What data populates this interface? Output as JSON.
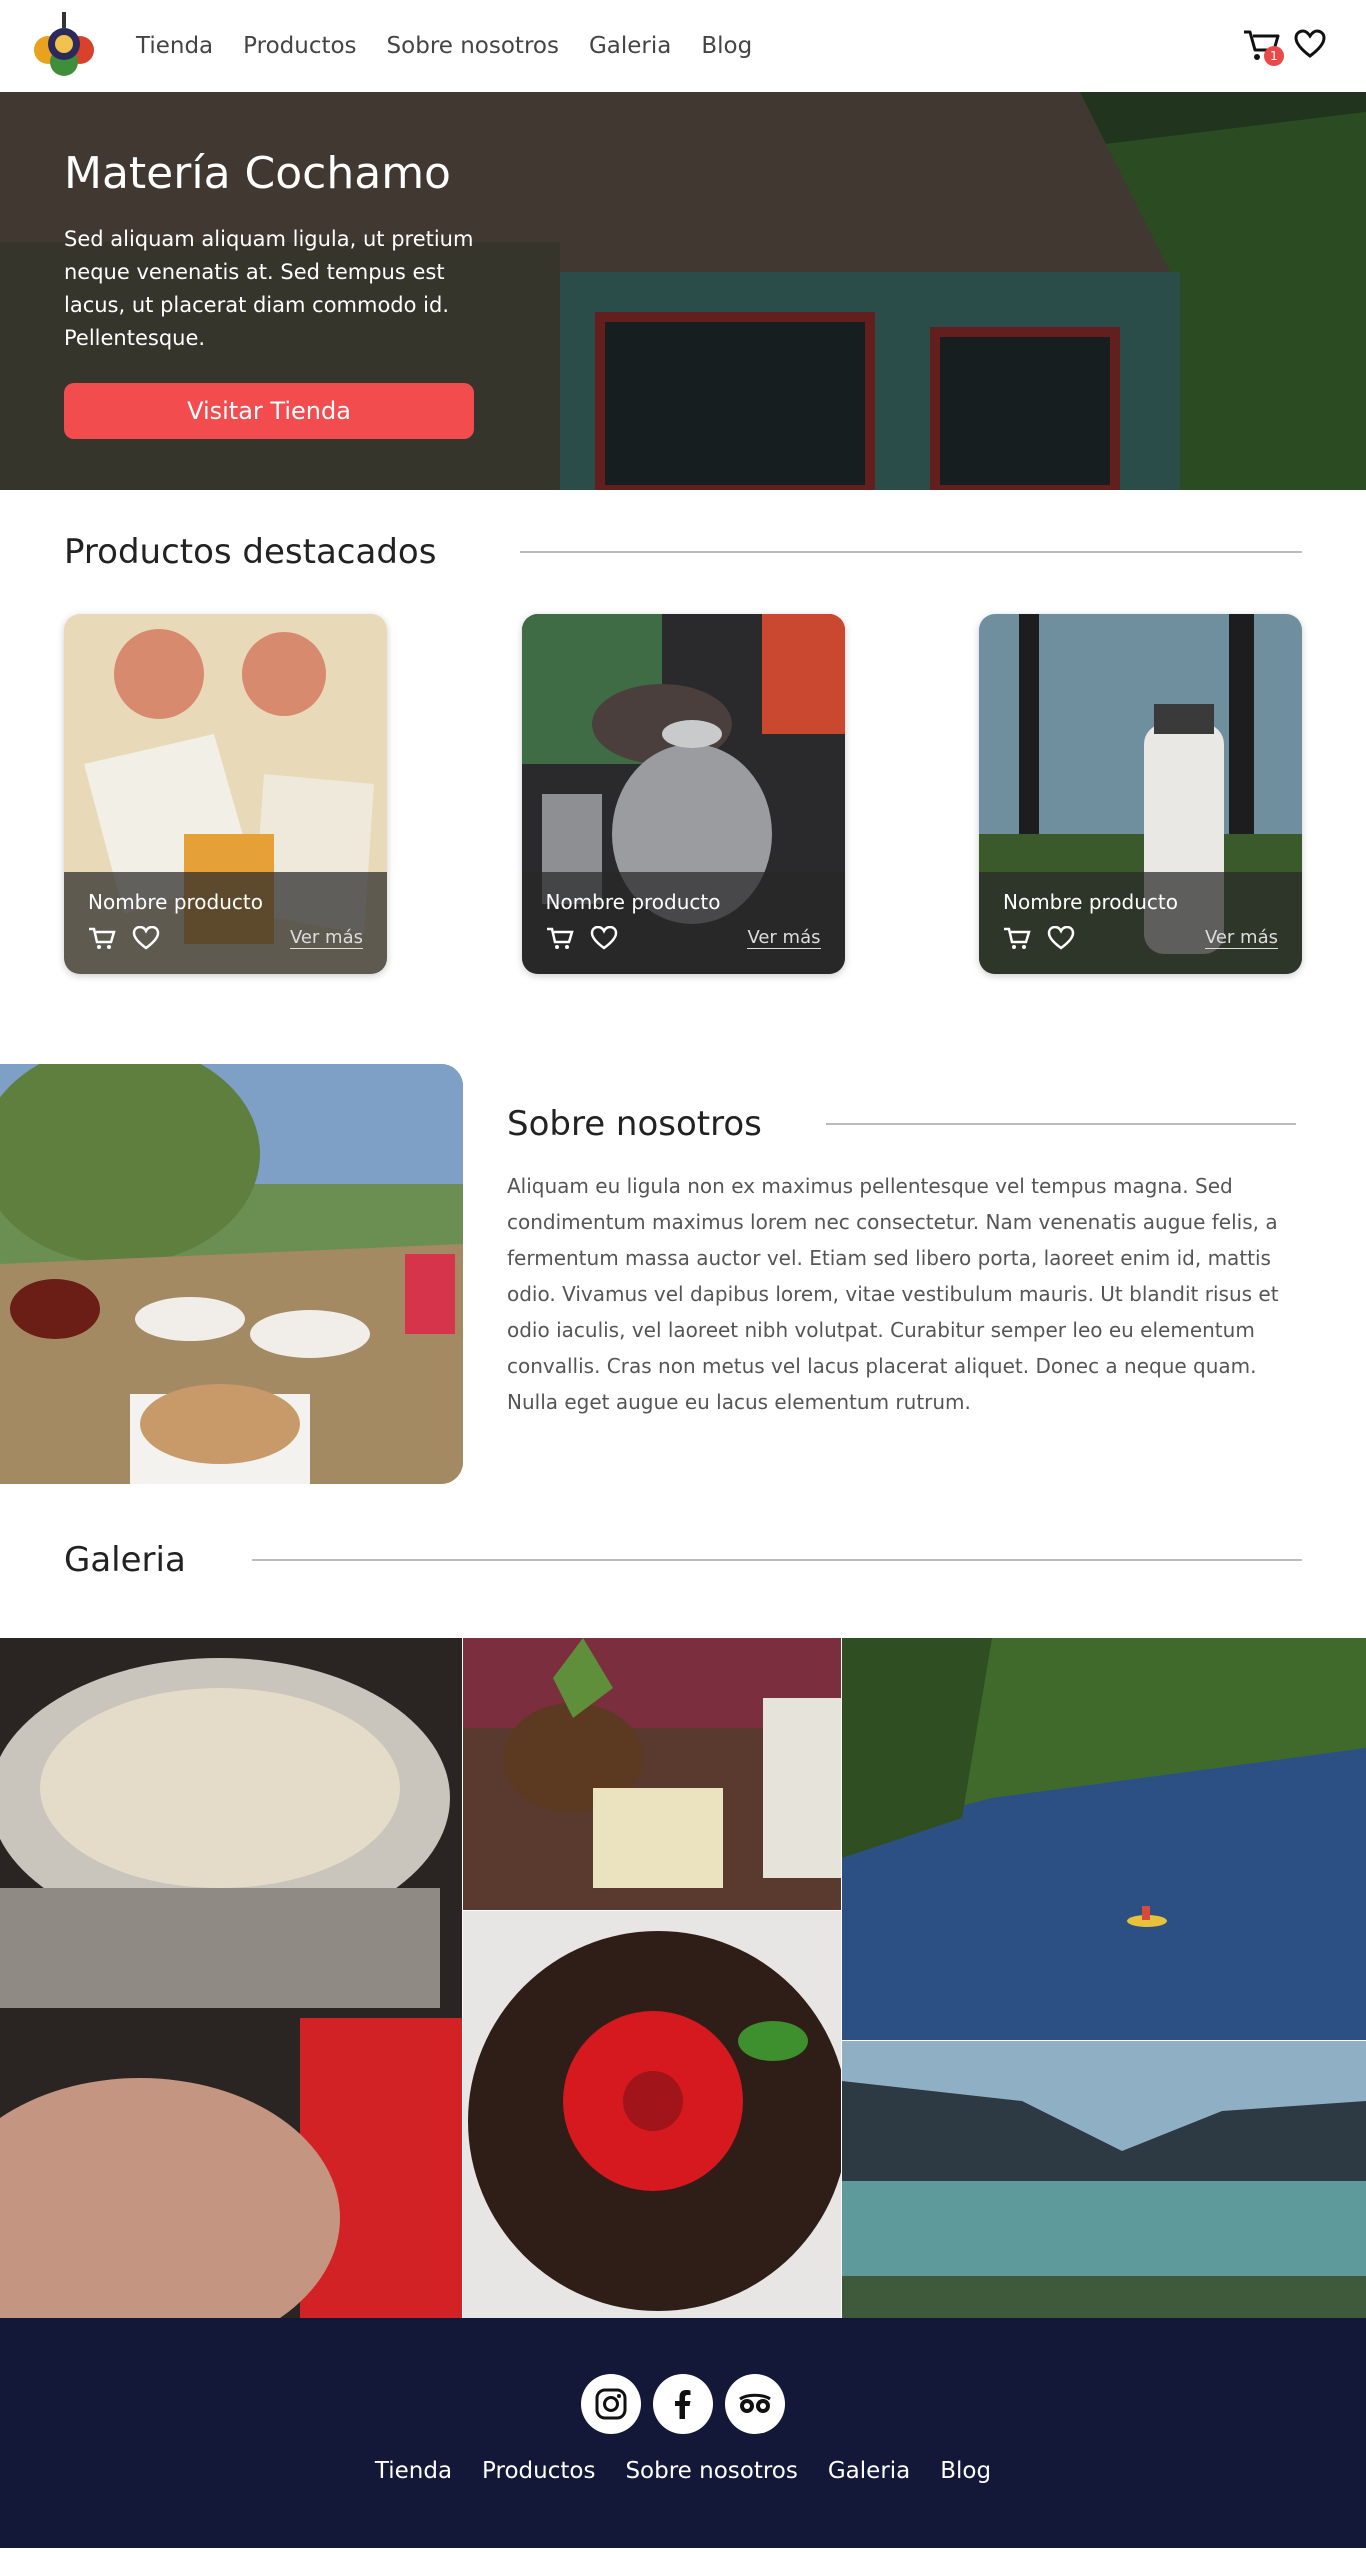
{
  "nav": {
    "links": [
      "Tienda",
      "Productos",
      "Sobre nosotros",
      "Galeria",
      "Blog"
    ],
    "cart_count": "1"
  },
  "hero": {
    "title": "Matería Cochamo",
    "text": "Sed aliquam aliquam ligula, ut pretium neque venenatis at. Sed tempus est lacus, ut placerat diam commodo id. Pellentesque.",
    "button": "Visitar Tienda"
  },
  "products": {
    "title": "Productos destacados",
    "items": [
      {
        "name": "Nombre producto",
        "more": "Ver más"
      },
      {
        "name": "Nombre producto",
        "more": "Ver más"
      },
      {
        "name": "Nombre producto",
        "more": "Ver más"
      }
    ]
  },
  "about": {
    "title": "Sobre nosotros",
    "text": "Aliquam eu ligula non ex maximus pellentesque vel tempus magna. Sed condimentum maximus lorem nec consectetur. Nam venenatis augue felis, a fermentum massa auctor vel. Etiam sed libero porta, laoreet enim id, mattis odio. Vivamus vel dapibus lorem, vitae vestibulum mauris. Ut blandit risus et odio iaculis, vel laoreet nibh volutpat. Curabitur semper leo eu elementum convallis. Cras non metus vel lacus placerat aliquet. Donec a neque quam. Nulla eget augue eu lacus elementum rutrum."
  },
  "gallery": {
    "title": "Galeria"
  },
  "footer": {
    "links": [
      "Tienda",
      "Productos",
      "Sobre nosotros",
      "Galeria",
      "Blog"
    ],
    "socials": [
      "instagram-icon",
      "facebook-icon",
      "tripadvisor-icon"
    ]
  },
  "colors": {
    "accent": "#f24c4f",
    "footer_bg": "#131838",
    "badge": "#e84a4a"
  }
}
